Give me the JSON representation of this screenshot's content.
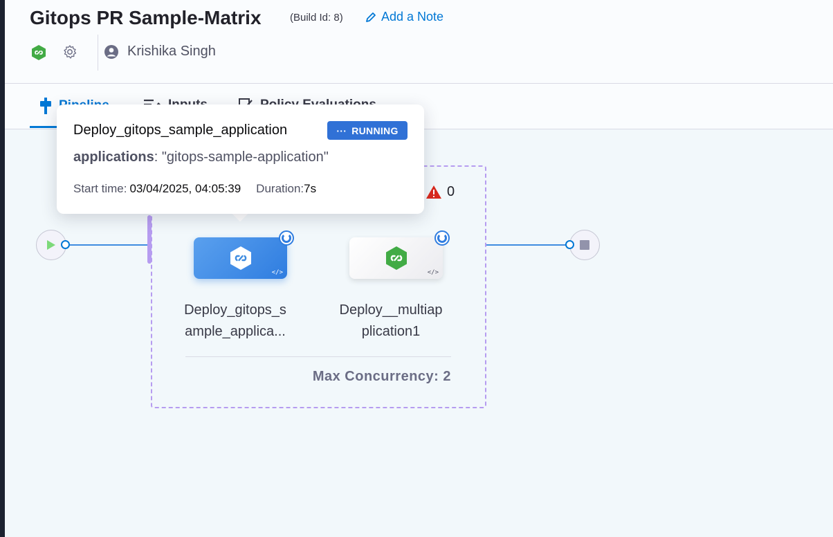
{
  "header": {
    "title": "Gitops PR Sample-Matrix",
    "build_id": "(Build Id: 8)",
    "add_note": "Add a Note",
    "user_name": "Krishika Singh"
  },
  "tabs": [
    {
      "label": "Pipeline",
      "active": true
    },
    {
      "label": "Inputs",
      "active": false
    },
    {
      "label": "Policy Evaluations",
      "active": false
    }
  ],
  "pipeline": {
    "warning_count": "0",
    "steps": [
      {
        "label": "Deploy_gitops_s ample_applica...",
        "state": "running",
        "selected": true
      },
      {
        "label": "Deploy__multiap plication1",
        "state": "running",
        "selected": false
      }
    ],
    "max_concurrency": "Max Concurrency: 2"
  },
  "tooltip": {
    "title": "Deploy_gitops_sample_application",
    "status": "RUNNING",
    "app_key": "applications",
    "app_value": ": \"gitops-sample-application\"",
    "start_label": "Start time:",
    "start_value": "03/04/2025, 04:05:39",
    "duration_label": "Duration:",
    "duration_value": "7s"
  },
  "colors": {
    "accent": "#0278d5",
    "running": "#3071d6",
    "matrix_border": "#b69cf0",
    "warning": "#da291d",
    "gitops_green": "#42ab45"
  }
}
